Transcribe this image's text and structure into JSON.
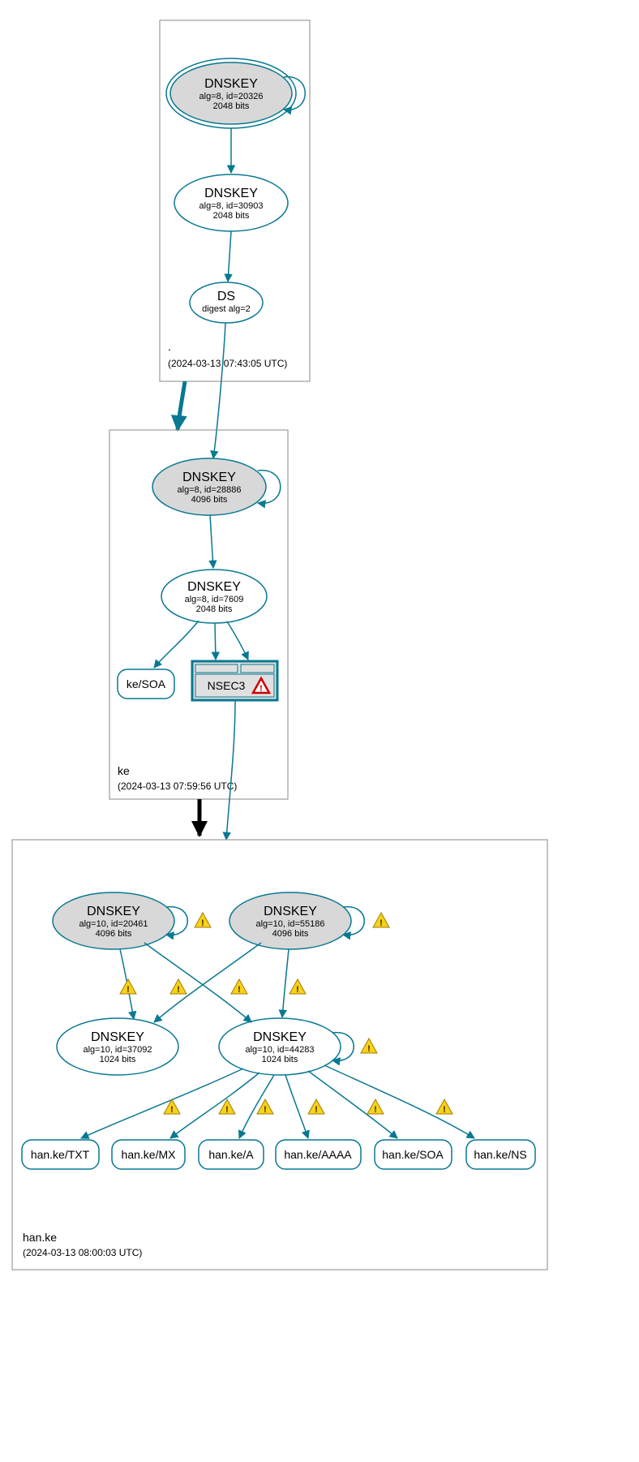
{
  "colors": {
    "teal": "#097891",
    "grey_fill": "#d8d8d8",
    "warn_fill": "#f7d21a",
    "err_stroke": "#cc0000"
  },
  "zones": {
    "root": {
      "label": ".",
      "time": "(2024-03-13 07:43:05 UTC)"
    },
    "ke": {
      "label": "ke",
      "time": "(2024-03-13 07:59:56 UTC)"
    },
    "hanke": {
      "label": "han.ke",
      "time": "(2024-03-13 08:00:03 UTC)"
    }
  },
  "nodes": {
    "root_ksk": {
      "title": "DNSKEY",
      "line2": "alg=8, id=20326",
      "line3": "2048 bits"
    },
    "root_zsk": {
      "title": "DNSKEY",
      "line2": "alg=8, id=30903",
      "line3": "2048 bits"
    },
    "root_ds": {
      "title": "DS",
      "line2": "digest alg=2"
    },
    "ke_ksk": {
      "title": "DNSKEY",
      "line2": "alg=8, id=28886",
      "line3": "4096 bits"
    },
    "ke_zsk": {
      "title": "DNSKEY",
      "line2": "alg=8, id=7609",
      "line3": "2048 bits"
    },
    "ke_soa": {
      "label": "ke/SOA"
    },
    "ke_nsec3": {
      "label": "NSEC3"
    },
    "hanke_ksk1": {
      "title": "DNSKEY",
      "line2": "alg=10, id=20461",
      "line3": "4096 bits"
    },
    "hanke_ksk2": {
      "title": "DNSKEY",
      "line2": "alg=10, id=55186",
      "line3": "4096 bits"
    },
    "hanke_zsk1": {
      "title": "DNSKEY",
      "line2": "alg=10, id=37092",
      "line3": "1024 bits"
    },
    "hanke_zsk2": {
      "title": "DNSKEY",
      "line2": "alg=10, id=44283",
      "line3": "1024 bits"
    },
    "rr_txt": {
      "label": "han.ke/TXT"
    },
    "rr_mx": {
      "label": "han.ke/MX"
    },
    "rr_a": {
      "label": "han.ke/A"
    },
    "rr_aaaa": {
      "label": "han.ke/AAAA"
    },
    "rr_soa": {
      "label": "han.ke/SOA"
    },
    "rr_ns": {
      "label": "han.ke/NS"
    }
  }
}
